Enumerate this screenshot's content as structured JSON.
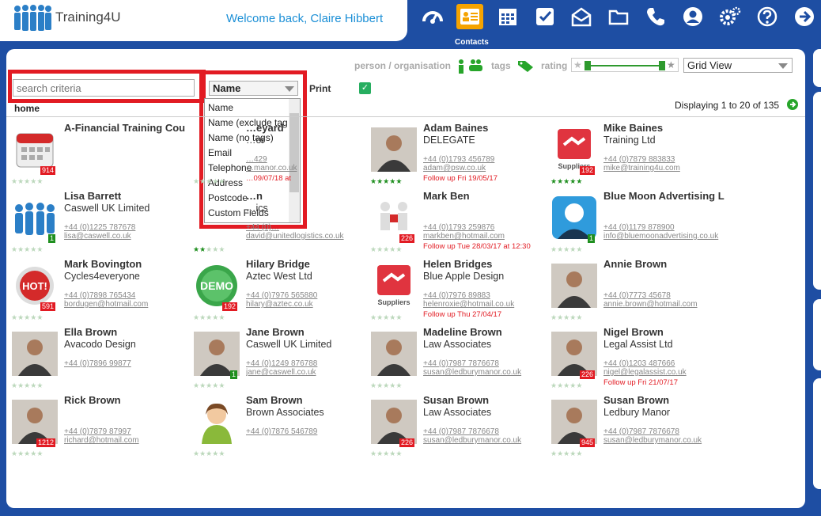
{
  "header": {
    "brand": "Training4U",
    "welcome": "Welcome back, Claire Hibbert",
    "active_caption": "Contacts",
    "nav": [
      {
        "name": "dashboard-icon"
      },
      {
        "name": "contacts-icon"
      },
      {
        "name": "calendar-icon"
      },
      {
        "name": "tasks-icon"
      },
      {
        "name": "mail-icon"
      },
      {
        "name": "folder-icon"
      },
      {
        "name": "phone-icon"
      },
      {
        "name": "user-icon"
      },
      {
        "name": "settings-icon"
      },
      {
        "name": "help-icon"
      },
      {
        "name": "logout-icon"
      }
    ],
    "colors": {
      "nav_bg": "#1e4ea3",
      "active": "#f5a300",
      "accent": "#1b8fd6"
    }
  },
  "toolbar": {
    "search_placeholder": "search criteria",
    "sort_field": "Name",
    "sort_options": [
      "Name",
      "Name (exclude tag",
      "Name (no tags)",
      "Email",
      "Telephone",
      "Address",
      "Postcode",
      "Custom Fields"
    ],
    "print_label": "Print",
    "print_checked": true,
    "breadcrumb": "home",
    "filter_person": "person / organisation",
    "filter_tags": "tags",
    "filter_rating": "rating",
    "view_mode": "Grid View",
    "displaying": "Displaying 1 to 20 of 135"
  },
  "contacts": [
    {
      "name": "A-Financial Training Cou",
      "company": "",
      "phone": "",
      "email": "",
      "follow": "",
      "badge": "914",
      "badge_color": "#e21b23",
      "stars": 0,
      "avatar": "calendar"
    },
    {
      "name": "…eyard",
      "company": "…or",
      "phone": "…429",
      "email": "…manor.co.uk",
      "follow": "…09/07/18 at",
      "badge": "",
      "badge_color": "",
      "stars": 0,
      "avatar": "none"
    },
    {
      "name": "Adam Baines",
      "company": "DELEGATE",
      "phone": "+44 (0)1793 456789",
      "email": "adam@psw.co.uk",
      "follow": "Follow up Fri 19/05/17",
      "badge": "",
      "badge_color": "",
      "stars": 5,
      "avatar": "person"
    },
    {
      "name": "Mike Baines",
      "company": "Training Ltd",
      "phone": "+44 (0)7879 883833",
      "email": "mike@training4u.com",
      "follow": "",
      "badge": "192",
      "badge_color": "#e21b23",
      "stars": 5,
      "avatar": "suppliers"
    },
    {
      "name": "Lisa Barrett",
      "company": "Caswell UK Limited",
      "phone": "+44 (0)1225 787678",
      "email": "lisa@caswell.co.uk",
      "follow": "",
      "badge": "1",
      "badge_color": "#1f8f1f",
      "stars": 0,
      "avatar": "group"
    },
    {
      "name": "…n",
      "company": "…ics",
      "phone": "+44 (0)…",
      "email": "david@unitedlogistics.co.uk",
      "follow": "",
      "badge": "",
      "badge_color": "",
      "stars": 2,
      "avatar": "none"
    },
    {
      "name": "Mark Ben",
      "company": "",
      "phone": "+44 (0)1793 259876",
      "email": "markben@hotmail.com",
      "follow": "Follow up Tue 28/03/17 at 12:30",
      "badge": "226",
      "badge_color": "#e21b23",
      "stars": 0,
      "avatar": "puzzle"
    },
    {
      "name": "Blue Moon Advertising L",
      "company": "",
      "phone": "+44 (0)1179 878900",
      "email": "info@bluemoonadvertising.co.uk",
      "follow": "",
      "badge": "1",
      "badge_color": "#1f8f1f",
      "stars": 0,
      "avatar": "silhouette"
    },
    {
      "name": "Mark Bovington",
      "company": "Cycles4everyone",
      "phone": "+44 (0)7898 765434",
      "email": "bordugen@hotmail.com",
      "follow": "",
      "badge": "591",
      "badge_color": "#e21b23",
      "stars": 0,
      "avatar": "hot"
    },
    {
      "name": "Hilary Bridge",
      "company": "Aztec West Ltd",
      "phone": "+44 (0)7976 565880",
      "email": "hilary@aztec.co.uk",
      "follow": "",
      "badge": "192",
      "badge_color": "#e21b23",
      "stars": 0,
      "avatar": "demo"
    },
    {
      "name": "Helen Bridges",
      "company": "Blue Apple Design",
      "phone": "+44 (0)7976 89883",
      "email": "helenroxie@hotmail.co.uk",
      "follow": "Follow up Thu 27/04/17",
      "badge": "",
      "badge_color": "",
      "stars": 0,
      "avatar": "suppliers"
    },
    {
      "name": "Annie Brown",
      "company": "",
      "phone": "+44 (0)7773 45678",
      "email": "annie.brown@hotmail.com",
      "follow": "",
      "badge": "",
      "badge_color": "",
      "stars": 0,
      "avatar": "person"
    },
    {
      "name": "Ella Brown",
      "company": "Avacodo Design",
      "phone": "+44 (0)7896 99877",
      "email": "",
      "follow": "",
      "badge": "",
      "badge_color": "",
      "stars": 0,
      "avatar": "person"
    },
    {
      "name": "Jane Brown",
      "company": "Caswell UK Limited",
      "phone": "+44 (0)1249 876788",
      "email": "jane@caswell.co.uk",
      "follow": "",
      "badge": "1",
      "badge_color": "#1f8f1f",
      "stars": 0,
      "avatar": "person"
    },
    {
      "name": "Madeline Brown",
      "company": "Law Associates",
      "phone": "+44 (0)7987 7876678",
      "email": "susan@ledburymanor.co.uk",
      "follow": "",
      "badge": "",
      "badge_color": "",
      "stars": 0,
      "avatar": "person"
    },
    {
      "name": "Nigel Brown",
      "company": "Legal Assist Ltd",
      "phone": "+44 (0)1203 487666",
      "email": "nigel@legalassist.co.uk",
      "follow": "Follow up Fri 21/07/17",
      "badge": "226",
      "badge_color": "#e21b23",
      "stars": 0,
      "avatar": "person"
    },
    {
      "name": "Rick Brown",
      "company": "",
      "phone": "+44 (0)7879 87997",
      "email": "richard@hotmail.com",
      "follow": "",
      "badge": "1212",
      "badge_color": "#e21b23",
      "stars": 0,
      "avatar": "person"
    },
    {
      "name": "Sam Brown",
      "company": "Brown Associates",
      "phone": "+44 (0)7876 546789",
      "email": "",
      "follow": "",
      "badge": "",
      "badge_color": "",
      "stars": 0,
      "avatar": "female"
    },
    {
      "name": "Susan Brown",
      "company": "Law Associates",
      "phone": "+44 (0)7987 7876678",
      "email": "susan@ledburymanor.co.uk",
      "follow": "",
      "badge": "226",
      "badge_color": "#e21b23",
      "stars": 0,
      "avatar": "person"
    },
    {
      "name": "Susan Brown",
      "company": "Ledbury Manor",
      "phone": "+44 (0)7987 7876678",
      "email": "susan@ledburymanor.co.uk",
      "follow": "",
      "badge": "945",
      "badge_color": "#e21b23",
      "stars": 0,
      "avatar": "person"
    }
  ]
}
